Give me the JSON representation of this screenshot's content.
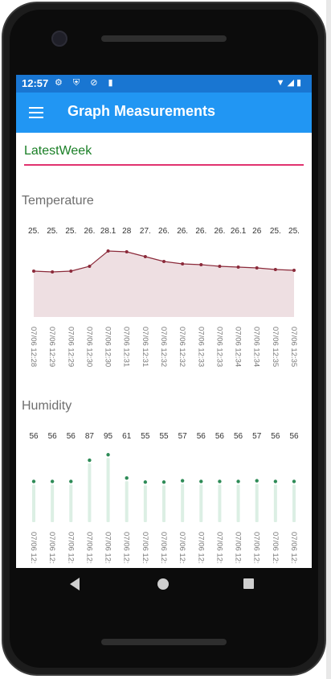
{
  "status_bar": {
    "time": "12:57",
    "left_icons": "⚙ ⛨ ⊘ ▮",
    "right_icons": "▼◢▮"
  },
  "app_bar": {
    "title": "Graph Measurements",
    "menu_icon": "hamburger-icon"
  },
  "picker": {
    "value": "LatestWeek"
  },
  "temperature": {
    "title": "Temperature",
    "point_labels": [
      "25.",
      "25.",
      "25.",
      "26.",
      "28.1",
      "28",
      "27.",
      "26.",
      "26.",
      "26.",
      "26.",
      "26.1",
      "26",
      "25.",
      "25."
    ],
    "x_labels": [
      "07/06 12:28",
      "07/06 12:29",
      "07/06 12:29",
      "07/06 12:30",
      "07/06 12:30",
      "07/06 12:31",
      "07/06 12:31",
      "07/06 12:32",
      "07/06 12:32",
      "07/06 12:33",
      "07/06 12:33",
      "07/06 12:34",
      "07/06 12:34",
      "07/06 12:35",
      "07/06 12:35"
    ],
    "colors": {
      "line": "#8b2a3a",
      "fill": "#eedfe2"
    }
  },
  "humidity": {
    "title": "Humidity",
    "point_labels": [
      "56",
      "56",
      "56",
      "87",
      "95",
      "61",
      "55",
      "55",
      "57",
      "56",
      "56",
      "56",
      "57",
      "56",
      "56"
    ],
    "x_labels": [
      "07/06 12:",
      "07/06 12:",
      "07/06 12:",
      "07/06 12:",
      "07/06 12:",
      "07/06 12:",
      "07/06 12:",
      "07/06 12:",
      "07/06 12:",
      "07/06 12:",
      "07/06 12:",
      "07/06 12:",
      "07/06 12:",
      "07/06 12:",
      "07/06 12:"
    ],
    "colors": {
      "point": "#2e8b57",
      "bar": "#dcefe4"
    }
  },
  "chart_data": [
    {
      "type": "area",
      "title": "Temperature",
      "x": [
        "07/06 12:28",
        "07/06 12:29",
        "07/06 12:29",
        "07/06 12:30",
        "07/06 12:30",
        "07/06 12:31",
        "07/06 12:31",
        "07/06 12:32",
        "07/06 12:32",
        "07/06 12:33",
        "07/06 12:33",
        "07/06 12:34",
        "07/06 12:34",
        "07/06 12:35",
        "07/06 12:35"
      ],
      "values": [
        25.6,
        25.5,
        25.6,
        26.2,
        28.1,
        28,
        27.4,
        26.8,
        26.5,
        26.4,
        26.2,
        26.1,
        26,
        25.8,
        25.7
      ],
      "ylim": [
        0,
        30
      ]
    },
    {
      "type": "scatter",
      "title": "Humidity",
      "x": [
        "07/06 12:",
        "07/06 12:",
        "07/06 12:",
        "07/06 12:",
        "07/06 12:",
        "07/06 12:",
        "07/06 12:",
        "07/06 12:",
        "07/06 12:",
        "07/06 12:",
        "07/06 12:",
        "07/06 12:",
        "07/06 12:",
        "07/06 12:",
        "07/06 12:"
      ],
      "values": [
        56,
        56,
        56,
        87,
        95,
        61,
        55,
        55,
        57,
        56,
        56,
        56,
        57,
        56,
        56
      ],
      "ylim": [
        0,
        100
      ]
    }
  ],
  "navbar": {
    "back": "back-icon",
    "home": "home-icon",
    "recent": "recent-apps-icon"
  }
}
